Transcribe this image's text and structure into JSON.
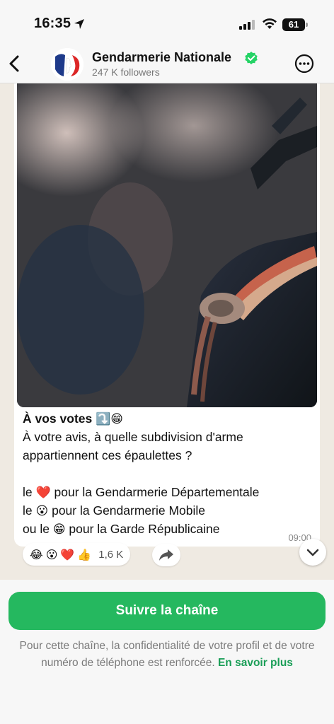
{
  "status_bar": {
    "time": "16:35",
    "battery": "61",
    "icons": [
      "location-arrow-icon",
      "signal-icon",
      "wifi-icon",
      "battery-icon"
    ]
  },
  "header": {
    "channel_name": "Gendarmerie Nationale",
    "followers": "247 K followers",
    "icons": [
      "back-chevron-icon",
      "marianne-logo",
      "verified-badge-icon",
      "more-options-icon"
    ]
  },
  "message": {
    "photo_alt": "photo",
    "lines": [
      {
        "text": "À vos votes ",
        "emoji": "⤵️😁"
      },
      {
        "text": "À votre avis, à quelle subdivision d'arme"
      },
      {
        "text": "appartiennent ces épaulettes ?"
      },
      {
        "text": ""
      },
      {
        "prefix": "le ",
        "emoji": "❤️",
        "text": " pour la Gendarmerie Départementale"
      },
      {
        "prefix": "le ",
        "emoji": "😮",
        "text": " pour la Gendarmerie Mobile"
      },
      {
        "prefix": "ou le ",
        "emoji": "😁",
        "text": " pour la Garde Républicaine"
      }
    ],
    "timestamp": "09:00"
  },
  "reactions": {
    "emojis": [
      "😂",
      "😮",
      "❤️",
      "👍"
    ],
    "count": "1,6 K"
  },
  "footer": {
    "follow_button": "Suivre la chaîne",
    "privacy_text": "Pour cette chaîne, la confidentialité de votre profil et de votre numéro de téléphone est renforcée. ",
    "learn_more": "En savoir plus"
  },
  "colors": {
    "accent_green": "#25b85f",
    "link_green": "#1a9e57",
    "verified_green": "#25d366",
    "chat_bg": "#efeae2"
  }
}
